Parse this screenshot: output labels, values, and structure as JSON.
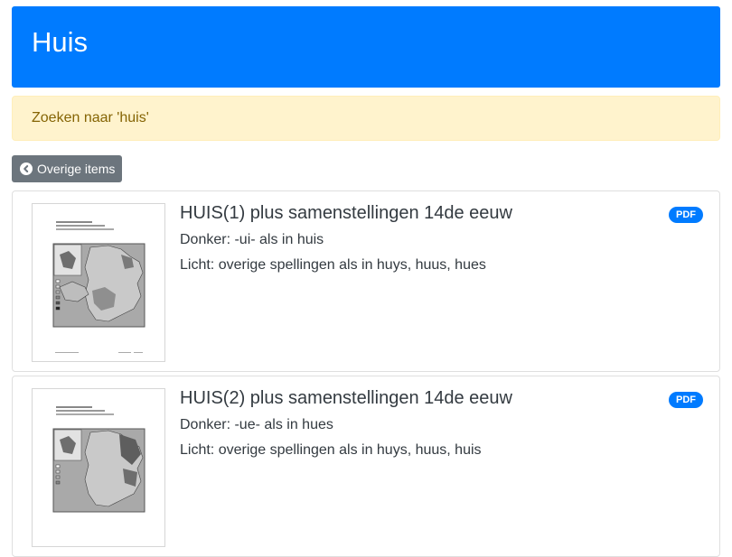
{
  "header": {
    "title": "Huis"
  },
  "alert": {
    "text": "Zoeken naar 'huis'"
  },
  "back_button": {
    "label": "Overige items",
    "icon": "chevron-left-circle-icon"
  },
  "colors": {
    "primary": "#007bff",
    "alert_bg": "#fff3cd",
    "alert_text": "#856404",
    "secondary": "#6c757d"
  },
  "items": [
    {
      "title": "HUIS(1) plus samenstellingen 14de eeuw",
      "dark": "Donker: -ui- als in huis",
      "light": "Licht: overige spellingen als in huys, huus, hues",
      "badge": "PDF"
    },
    {
      "title": "HUIS(2) plus samenstellingen 14de eeuw",
      "dark": "Donker: -ue- als in hues",
      "light": "Licht: overige spellingen als in huys, huus, huis",
      "badge": "PDF"
    }
  ]
}
